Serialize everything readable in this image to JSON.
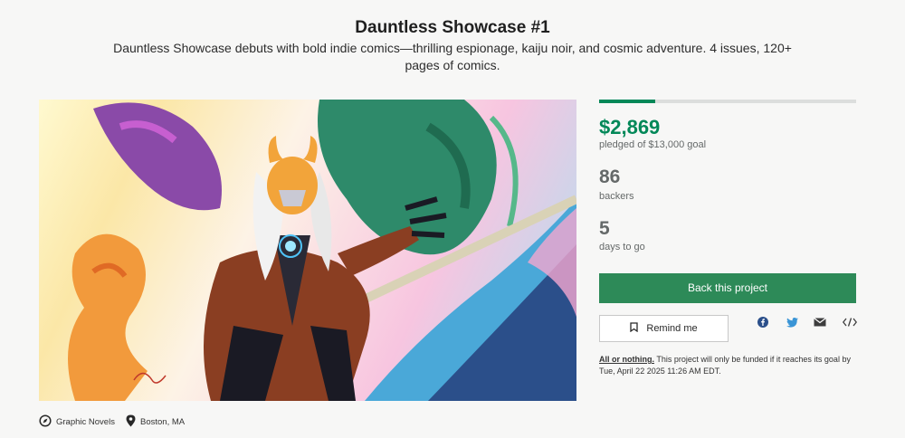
{
  "project": {
    "title": "Dauntless Showcase #1",
    "blurb": "Dauntless Showcase debuts with bold indie comics—thrilling espionage, kaiju noir, and cosmic adventure. 4 issues, 120+ pages of comics."
  },
  "stats": {
    "progress_fraction": 0.22,
    "pledged": "$2,869",
    "pledged_label": "pledged of $13,000 goal",
    "backers": "86",
    "backers_label": "backers",
    "days": "5",
    "days_label": "days to go"
  },
  "actions": {
    "back_label": "Back this project",
    "remind_label": "Remind me"
  },
  "share_icons": [
    "facebook-icon",
    "twitter-icon",
    "email-icon",
    "embed-icon"
  ],
  "funding_note": {
    "link": "All or nothing.",
    "text": " This project will only be funded if it reaches its goal by Tue, April 22 2025 11:26 AM EDT."
  },
  "meta": {
    "category": "Graphic Novels",
    "location": "Boston, MA"
  },
  "colors": {
    "accent": "#028858",
    "button": "#2d8a58",
    "muted": "#656969"
  }
}
